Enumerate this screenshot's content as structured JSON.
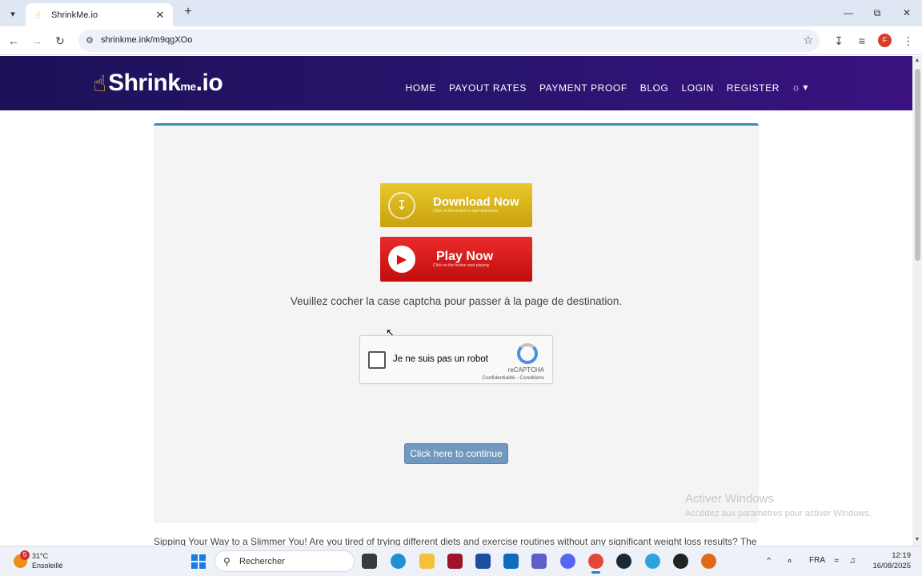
{
  "browser": {
    "tab_title": "ShrinkMe.io",
    "url": "shrinkme.ink/m9qgXOo",
    "profile_initial": "F"
  },
  "site": {
    "logo_text_a": "Shrink",
    "logo_text_b": "me",
    "logo_text_c": ".io",
    "nav": [
      "HOME",
      "PAYOUT RATES",
      "PAYMENT PROOF",
      "BLOG",
      "LOGIN",
      "REGISTER"
    ],
    "lang_icon": "translate-icon"
  },
  "content": {
    "download_btn": {
      "main": "Download Now",
      "sub": "Click on the button to start download"
    },
    "play_btn": {
      "main": "Play Now",
      "sub": "Click on the button start playing"
    },
    "instruction": "Veuillez cocher la case captcha pour passer à la page de destination.",
    "recaptcha": {
      "label": "Je ne suis pas un robot",
      "brand": "reCAPTCHA",
      "terms": "Confidentialité - Conditions"
    },
    "continue_label": "Click here to continue",
    "article_snippet": "Sipping Your Way to a Slimmer You! Are you tired of trying different diets and exercise routines without any significant weight loss results? The"
  },
  "watermark": {
    "title": "Activer Windows",
    "subtitle": "Accédez aux paramètres pour activer Windows."
  },
  "taskbar": {
    "weather_badge": "5",
    "weather_temp": "31°C",
    "weather_desc": "Ensoleillé",
    "search_label": "Rechercher",
    "lang": "FRA",
    "time": "12:19",
    "date": "16/08/2025"
  },
  "colors": {
    "header_bg": "#2a1470",
    "card_accent": "#3c8dbc",
    "continue_btn": "#7199bf",
    "download_btn": "#d4b11c",
    "play_btn": "#d91616"
  }
}
